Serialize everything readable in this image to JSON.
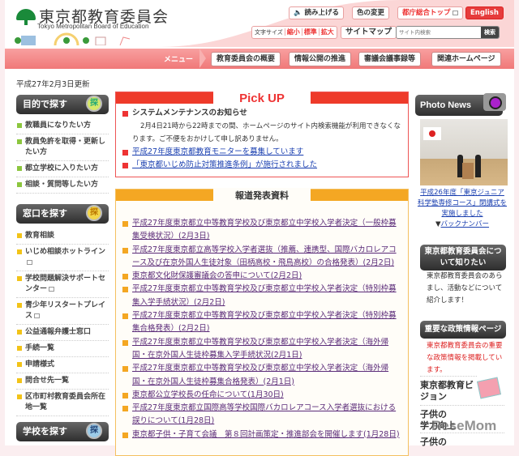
{
  "header": {
    "logo_jp": "東京都教育委員会",
    "logo_en": "Tokyo Metropolitan Board of Education",
    "read_aloud": "読み上げる",
    "color_change": "色の変更",
    "metro_top": "都庁総合トップ",
    "english": "English",
    "font_size_label": "文字サイズ",
    "font_small": "縮小",
    "font_normal": "標準",
    "font_large": "拡大",
    "sitemap": "サイトマップ",
    "search_placeholder": "サイト内検索",
    "search_button": "検索"
  },
  "nav": {
    "label": "メニュー",
    "items": [
      "教育委員会の概要",
      "情報公開の推進",
      "審議会議事録等",
      "関連ホームページ"
    ]
  },
  "updated": "平成27年2月3日更新",
  "sidebar": {
    "purpose": {
      "title": "目的で探す",
      "icon": "探",
      "items": [
        "教職員になりたい方",
        "教員免許を取得・更新したい方",
        "都立学校に入りたい方",
        "相談・質問等したい方"
      ]
    },
    "window": {
      "title": "窓口を探す",
      "icon": "探",
      "items": [
        "教育相談",
        "いじめ相談ホットライン",
        "学校問題解決サポートセンター",
        "青少年リスタートプレイス",
        "公益通報弁護士窓口",
        "手続一覧",
        "申請様式",
        "問合せ先一覧",
        "区市町村教育委員会所在地一覧"
      ]
    },
    "school": {
      "title": "学校を探す",
      "icon": "探"
    }
  },
  "pickup": {
    "title": "Pick UP",
    "items": [
      {
        "title": "システムメンテナンスのお知らせ",
        "desc": "2月4日21時から22時までの間、ホームページのサイト内検索機能が利用できなくなります。ご不便をおかけして申し訳ありません。"
      },
      {
        "title": "平成27年度東京都教育モニターを募集しています"
      },
      {
        "title": "「東京都いじめ防止対策推進条例」が施行されました"
      }
    ]
  },
  "press": {
    "title": "報道発表資料",
    "items": [
      "平成27年度東京都立中等教育学校及び東京都立中学校入学者決定（一般枠募集受検状況）(2月3日)",
      "平成27年度東京都立高等学校入学者選抜（推薦、連携型、国際バカロレアコース及び在京外国人生徒対象（田柄高校・飛鳥高校）の合格発表）(2月2日)",
      "東京都文化財保護審議会の答申について(2月2日)",
      "平成27年度東京都立中等教育学校及び東京都立中学校入学者決定（特別枠募集入学手続状況）(2月2日)",
      "平成27年度東京都立中等教育学校及び東京都立中学校入学者決定（特別枠募集合格発表）(2月2日)",
      "平成27年度東京都立中等教育学校及び東京都立中学校入学者決定（海外帰国・在京外国人生徒枠募集入学手続状況(2月1日)",
      "平成27年度東京都立中等教育学校及び東京都立中学校入学者決定（海外帰国・在京外国人生徒枠募集合格発表）(2月1日)",
      "東京都公立学校長の任命について(1月30日)",
      "平成27年度東京都立国際高等学校国際バカロレアコース入学者選抜における誤りについて(1月28日)",
      "東京都子供・子育て会議　第８回計画策定・推進部会を開催します(1月28日)"
    ]
  },
  "right": {
    "photo_news": "Photo News",
    "photo_caption": "平成26年度「東京ジュニア科学塾専修コース」閉講式を実施しました",
    "back_number": "バックナンバー",
    "about_title": "東京都教育委員会について知りたい",
    "about_desc": "東京都教育委員会のあらまし、活動などについて紹介します！",
    "policy_title": "重要な政策情報ページ",
    "policy_desc": "東京都教育委員会の重要な政策情報を掲載しています。",
    "vision": "東京都教育ビジョン",
    "child1_a": "子供の",
    "child1_b": "学力向上",
    "child2": "子供の"
  },
  "watermark": "ReseMom"
}
